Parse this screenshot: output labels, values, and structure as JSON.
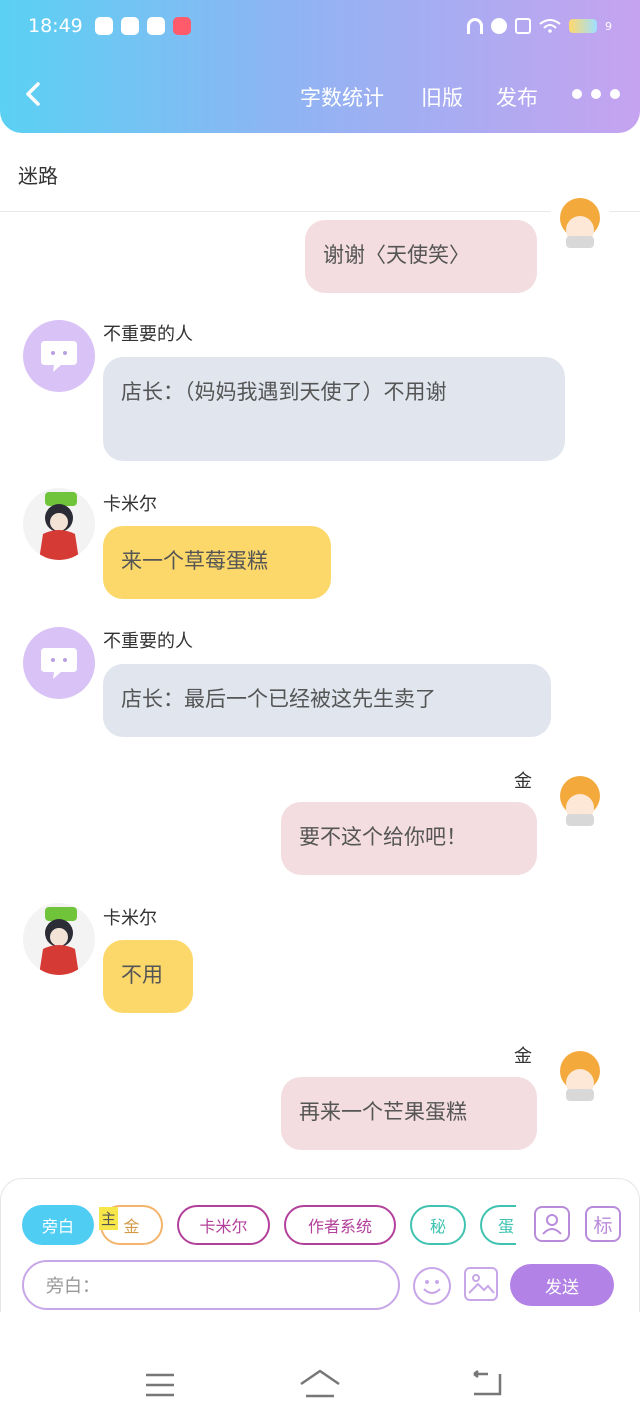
{
  "status_bar": {
    "time": "18:49",
    "battery_label": "9"
  },
  "header": {
    "stats_label": "字数统计",
    "old_version_label": "旧版",
    "publish_label": "发布"
  },
  "chat_title": "迷路",
  "messages": [
    {
      "side": "right",
      "name": "",
      "text": "谢谢〈天使笑〉"
    },
    {
      "side": "left",
      "name": "不重要的人",
      "text": "店长：（妈妈我遇到天使了）不用谢"
    },
    {
      "side": "left",
      "name": "卡米尔",
      "text": "来一个草莓蛋糕"
    },
    {
      "side": "left",
      "name": "不重要的人",
      "text": "店长：最后一个已经被这先生卖了"
    },
    {
      "side": "right",
      "name": "金",
      "text": "要不这个给你吧！"
    },
    {
      "side": "left",
      "name": "卡米尔",
      "text": "不用"
    },
    {
      "side": "right",
      "name": "金",
      "text": "再来一个芒果蛋糕"
    }
  ],
  "role_chips": {
    "narration": "旁白",
    "gold_marker": "主",
    "gold": "金",
    "kamil": "卡米尔",
    "author_system": "作者系统",
    "secret": "秘",
    "cut": "蛋"
  },
  "side_buttons": {
    "tag": "标"
  },
  "input": {
    "placeholder": "旁白："
  },
  "send_label": "发送",
  "colors": {
    "header_start": "#5ad1f3",
    "header_end": "#c6a3f0",
    "pink_bubble": "#f3dde0",
    "gray_bubble": "#e1e6ee",
    "yellow_bubble": "#fcd86b",
    "send": "#b282e6",
    "active_chip": "#4fcdf3"
  }
}
